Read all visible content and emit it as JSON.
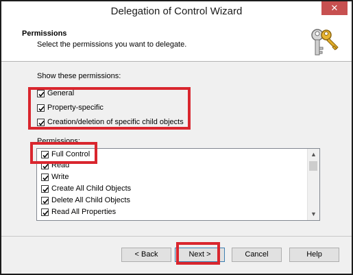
{
  "window": {
    "title": "Delegation of Control Wizard",
    "close_glyph": "✕"
  },
  "header": {
    "title": "Permissions",
    "subtitle": "Select the permissions you want to delegate.",
    "icon": "keys-icon"
  },
  "filters": {
    "label": "Show these permissions:",
    "items": [
      {
        "label": "General",
        "checked": true
      },
      {
        "label": "Property-specific",
        "checked": true
      },
      {
        "label": "Creation/deletion of specific child objects",
        "checked": true
      }
    ]
  },
  "permissions": {
    "label": "Permissions:",
    "items": [
      {
        "label": "Full Control",
        "checked": true
      },
      {
        "label": "Read",
        "checked": true
      },
      {
        "label": "Write",
        "checked": true
      },
      {
        "label": "Create All Child Objects",
        "checked": true
      },
      {
        "label": "Delete All Child Objects",
        "checked": true
      },
      {
        "label": "Read All Properties",
        "checked": true
      }
    ]
  },
  "buttons": {
    "back": "< Back",
    "next": "Next >",
    "cancel": "Cancel",
    "help": "Help"
  },
  "colors": {
    "highlight": "#d9262e",
    "close_button": "#c75050"
  }
}
